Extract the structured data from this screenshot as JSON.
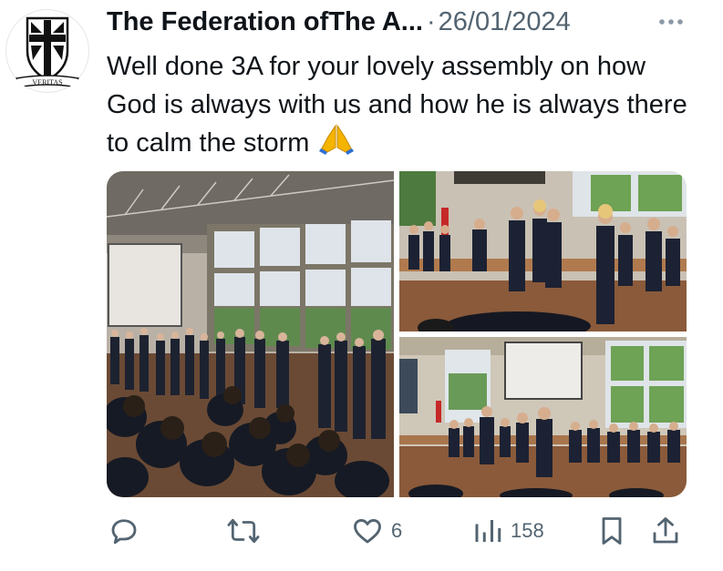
{
  "post": {
    "author_display": "The Federation ofThe A...",
    "separator": "·",
    "date": "26/01/2024",
    "text": "Well done 3A for your lovely assembly on how God is always with us and how he is always there to calm the storm",
    "emoji_icon": "praying-hands-icon"
  },
  "avatar": {
    "crest_motto": "VERITAS",
    "icon": "school-crest-icon"
  },
  "media": {
    "images": [
      {
        "name": "assembly-hall-photo"
      },
      {
        "name": "pupils-presenting-photo"
      },
      {
        "name": "class-on-stage-photo"
      }
    ]
  },
  "actions": {
    "reply": {
      "icon": "reply-icon",
      "count": ""
    },
    "repost": {
      "icon": "repost-icon",
      "count": ""
    },
    "like": {
      "icon": "heart-icon",
      "count": "6"
    },
    "views": {
      "icon": "views-icon",
      "count": "158"
    },
    "bookmark": {
      "icon": "bookmark-icon"
    },
    "share": {
      "icon": "share-icon"
    }
  },
  "colors": {
    "text_primary": "#0f1419",
    "text_secondary": "#536471",
    "emoji": "#f4b400"
  }
}
